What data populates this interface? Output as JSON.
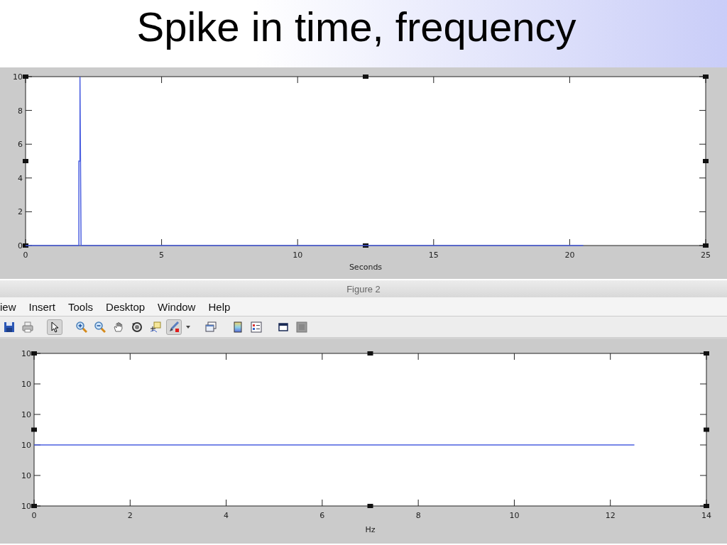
{
  "slide": {
    "title": "Spike in time, frequency"
  },
  "figure_top": {
    "chart_data": {
      "type": "line",
      "xlabel": "Seconds",
      "x": [
        0,
        1.96,
        1.96,
        2,
        2,
        2.04,
        20.5
      ],
      "series": [
        {
          "color": "#4b5fe0",
          "values": [
            0,
            0,
            5,
            5,
            10,
            0,
            0
          ]
        }
      ],
      "xlim": [
        0,
        25
      ],
      "ylim": [
        0,
        10
      ],
      "xticks": [
        0,
        5,
        10,
        15,
        20,
        25
      ],
      "yticks": [
        0,
        2,
        4,
        6,
        8,
        10
      ]
    }
  },
  "window": {
    "title": "Figure 2"
  },
  "menu": [
    {
      "label": "iew"
    },
    {
      "label": "Insert"
    },
    {
      "label": "Tools"
    },
    {
      "label": "Desktop"
    },
    {
      "label": "Window"
    },
    {
      "label": "Help"
    }
  ],
  "toolbar": [
    {
      "kind": "save",
      "selected": false
    },
    {
      "kind": "print",
      "selected": false
    },
    {
      "kind": "pointer",
      "selected": true
    },
    {
      "kind": "zoomin",
      "selected": false
    },
    {
      "kind": "zoomout",
      "selected": false
    },
    {
      "kind": "pan",
      "selected": false
    },
    {
      "kind": "rotate",
      "selected": false
    },
    {
      "kind": "datacursor",
      "selected": false
    },
    {
      "kind": "brush",
      "selected": true
    },
    {
      "kind": "caret",
      "selected": false
    },
    {
      "kind": "link",
      "selected": false
    },
    {
      "kind": "colorbar",
      "selected": false
    },
    {
      "kind": "legend",
      "selected": false
    },
    {
      "kind": "window",
      "selected": false
    },
    {
      "kind": "square",
      "selected": false
    }
  ],
  "figure_bottom": {
    "y_tick_labels": [
      "10",
      "10",
      "10",
      "10",
      "10",
      "10"
    ],
    "x_tick_labels": [
      "0",
      "2",
      "4",
      "6",
      "8",
      "10",
      "12",
      "14"
    ],
    "xlabel": "Hz"
  }
}
